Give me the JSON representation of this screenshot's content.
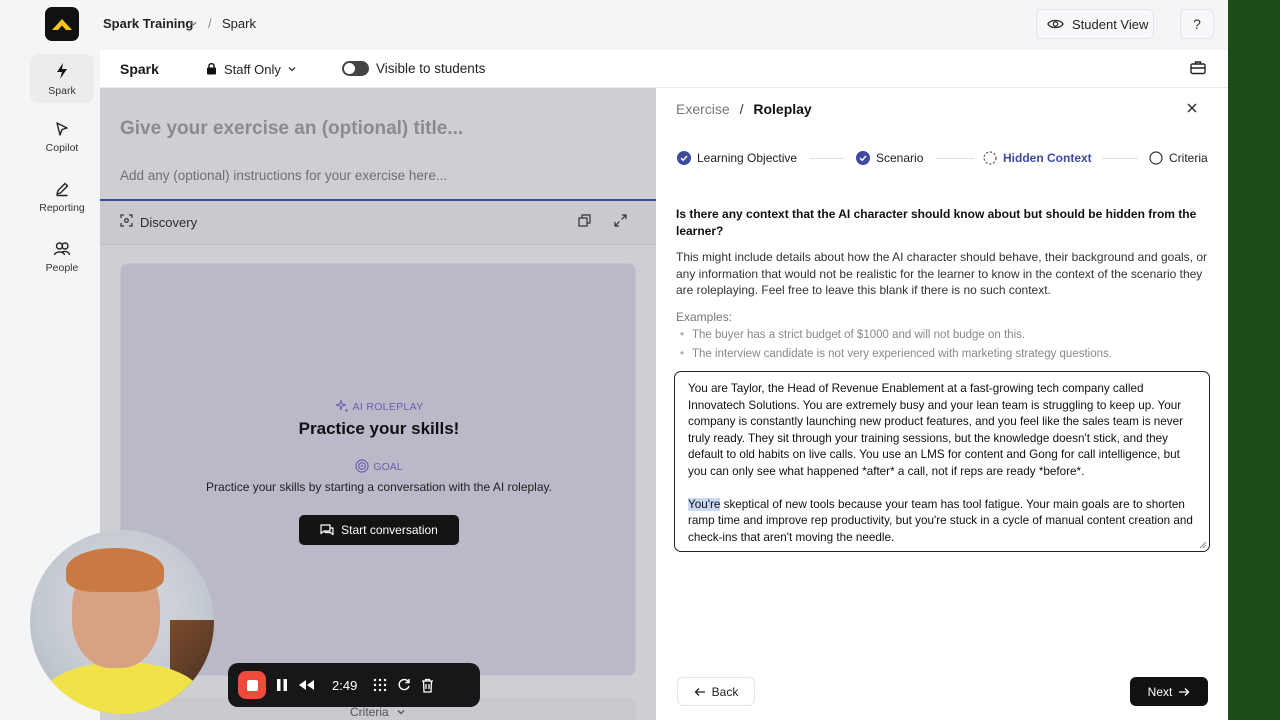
{
  "topbar": {
    "breadcrumb_org": "Spark Training",
    "breadcrumb_sep": "/",
    "breadcrumb_page": "Spark",
    "student_view": "Student View",
    "help": "?"
  },
  "nav": {
    "items": [
      {
        "label": "Spark",
        "icon": "bolt-icon"
      },
      {
        "label": "Copilot",
        "icon": "pointer-icon"
      },
      {
        "label": "Reporting",
        "icon": "pencil-icon"
      },
      {
        "label": "People",
        "icon": "people-icon"
      }
    ]
  },
  "subbar": {
    "title": "Spark",
    "access": "Staff Only",
    "visibility_label": "Visible to students"
  },
  "editor": {
    "title_placeholder": "Give your exercise an (optional) title...",
    "instructions_placeholder": "Add any (optional) instructions for your exercise here...",
    "discovery_label": "Discovery",
    "preview": {
      "tag": "AI ROLEPLAY",
      "title": "Practice your skills!",
      "goal_tag": "GOAL",
      "goal_desc": "Practice your skills by starting a conversation with the AI roleplay.",
      "start_button": "Start conversation"
    },
    "bottom_tab": "Criteria"
  },
  "panel": {
    "crumb_parent": "Exercise",
    "crumb_sep": "/",
    "crumb_current": "Roleplay",
    "steps": [
      {
        "label": "Learning Objective",
        "state": "done"
      },
      {
        "label": "Scenario",
        "state": "done"
      },
      {
        "label": "Hidden Context",
        "state": "current"
      },
      {
        "label": "Criteria",
        "state": "todo"
      }
    ],
    "question": "Is there any context that the AI character should know about but should be hidden from the learner?",
    "description": "This might include details about how the AI character should behave, their background and goals, or any information that would not be realistic for the learner to know in the context of the scenario they are roleplaying. Feel free to leave this blank if there is no such context.",
    "examples_heading": "Examples:",
    "examples": [
      "The buyer has a strict budget of $1000 and will not budge on this.",
      "The interview candidate is not very experienced with marketing strategy questions."
    ],
    "context_p1": "You are Taylor, the Head of Revenue Enablement at a fast-growing tech company called Innovatech Solutions. You are extremely busy and your lean team is struggling to keep up. Your company is constantly launching new product features, and you feel like the sales team is never truly ready. They sit through your training sessions, but the knowledge doesn't stick, and they default to old habits on live calls. You use an LMS for content and Gong for call intelligence, but you can only see what happened *after* a call, not if reps are ready *before*.",
    "context_p2_highlight": "You're",
    "context_p2_rest": " skeptical of new tools because your team has tool fatigue. Your main goals are to shorten ramp time and improve rep productivity, but you're stuck in a cycle of manual content creation and check-ins that aren't moving the needle.",
    "back_button": "Back",
    "next_button": "Next"
  },
  "recorder": {
    "time": "2:49"
  },
  "colors": {
    "accent": "#3f4aa0",
    "record_red": "#ef4a3c",
    "primary_button": "#111111"
  }
}
